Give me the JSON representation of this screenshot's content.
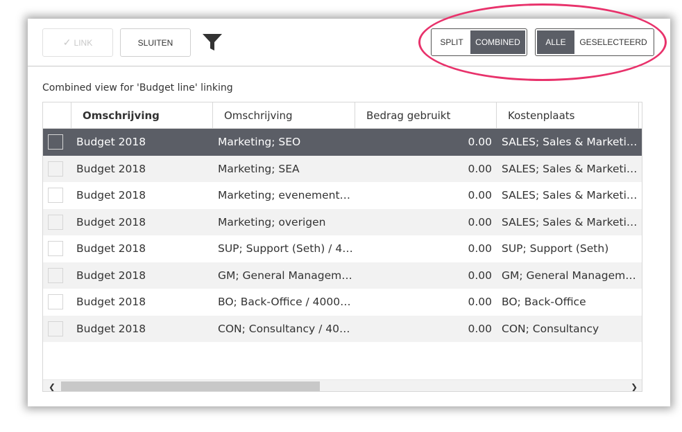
{
  "toolbar": {
    "link_label": "LINK",
    "close_label": "SLUITEN",
    "filter_icon": "filter-icon",
    "view_toggle": {
      "options": [
        "SPLIT",
        "COMBINED"
      ],
      "active": "COMBINED"
    },
    "scope_toggle": {
      "options": [
        "ALLE",
        "GESELECTEERD"
      ],
      "active": "ALLE"
    }
  },
  "caption": "Combined view for 'Budget line' linking",
  "grid": {
    "columns": [
      "Omschrijving",
      "Omschrijving",
      "Bedrag gebruikt",
      "Kostenplaats"
    ],
    "rows": [
      {
        "c1": "Budget 2018",
        "c2": "Marketing; SEO",
        "c3": "0.00",
        "c4": "SALES; Sales & Marketi…",
        "selected": true
      },
      {
        "c1": "Budget 2018",
        "c2": "Marketing; SEA",
        "c3": "0.00",
        "c4": "SALES; Sales & Marketi…"
      },
      {
        "c1": "Budget 2018",
        "c2": "Marketing; evenement…",
        "c3": "0.00",
        "c4": "SALES; Sales & Marketi…"
      },
      {
        "c1": "Budget 2018",
        "c2": "Marketing; overigen",
        "c3": "0.00",
        "c4": "SALES; Sales & Marketi…"
      },
      {
        "c1": "Budget 2018",
        "c2": "SUP; Support (Seth) / 4…",
        "c3": "0.00",
        "c4": "SUP; Support (Seth)"
      },
      {
        "c1": "Budget 2018",
        "c2": "GM; General Managem…",
        "c3": "0.00",
        "c4": "GM; General Managem…"
      },
      {
        "c1": "Budget 2018",
        "c2": "BO; Back-Office / 4000;…",
        "c3": "0.00",
        "c4": "BO; Back-Office"
      },
      {
        "c1": "Budget 2018",
        "c2": "CON; Consultancy / 40…",
        "c3": "0.00",
        "c4": "CON; Consultancy"
      }
    ]
  },
  "colors": {
    "accent_dark": "#5b5e66",
    "highlight": "#e8326b"
  }
}
